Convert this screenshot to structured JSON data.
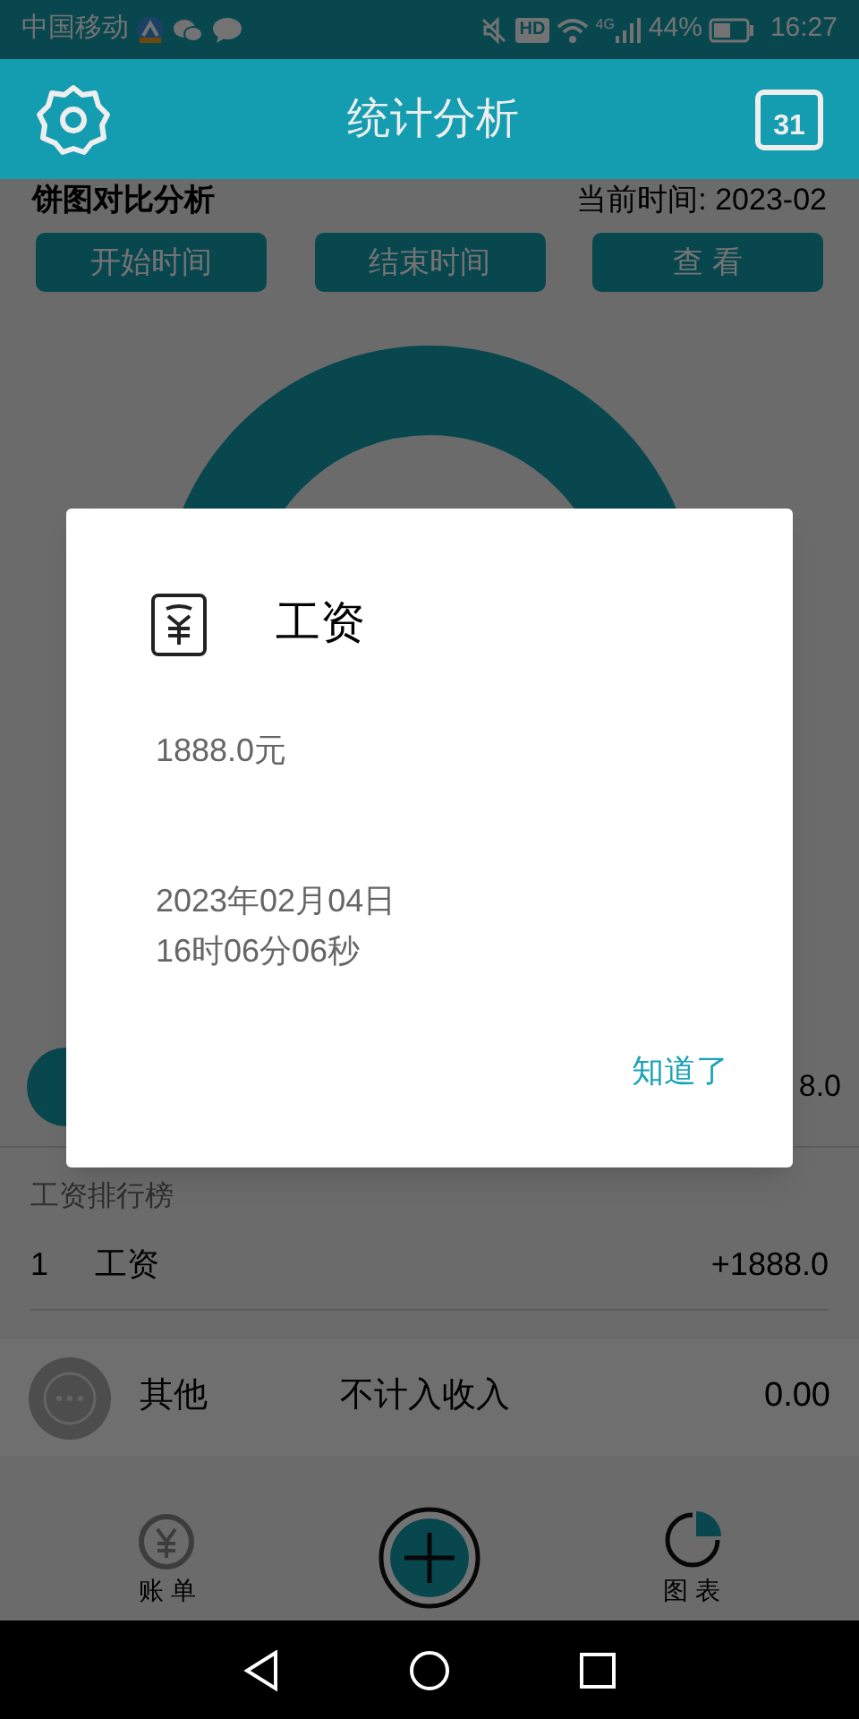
{
  "status_bar": {
    "carrier": "中国移动",
    "hd": "HD",
    "network": "4G",
    "battery_percent": "44%",
    "time": "16:27"
  },
  "app_bar": {
    "title": "统计分析",
    "calendar_day": "31"
  },
  "summary": {
    "heading": "饼图对比分析",
    "current_time": "当前时间: 2023-02"
  },
  "buttons": [
    "开始时间",
    "结束时间",
    "查 看"
  ],
  "category_row": {
    "amount": "8.0"
  },
  "ranking": {
    "title": "工资排行榜",
    "rows": [
      {
        "rank": "1",
        "name": "工资",
        "amount": "+1888.0"
      }
    ]
  },
  "other_row": {
    "name": "其他",
    "note": "不计入收入",
    "amount": "0.00"
  },
  "bottom_nav": [
    {
      "label": "账 单",
      "kind": "bill",
      "selected": false
    },
    {
      "kind": "add"
    },
    {
      "label": "图 表",
      "kind": "chart",
      "selected": true
    }
  ],
  "dialog": {
    "title": "工资",
    "amount": "1888.0元",
    "date": "2023年02月04日",
    "time": "16时06分06秒",
    "button": "知道了"
  }
}
